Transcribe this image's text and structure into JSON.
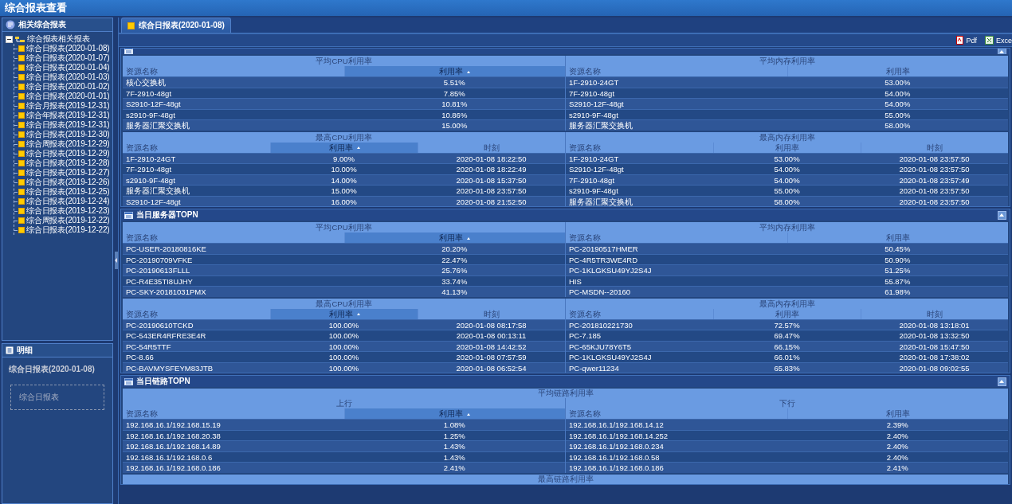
{
  "window": {
    "title": "综合报表查看"
  },
  "sidebar": {
    "related": {
      "title": "相关综合报表",
      "tree": {
        "label": "综合报表相关报表",
        "expanded": true,
        "children": [
          {
            "label": "综合日报表(2020-01-08)"
          },
          {
            "label": "综合日报表(2020-01-07)"
          },
          {
            "label": "综合日报表(2020-01-04)"
          },
          {
            "label": "综合日报表(2020-01-03)"
          },
          {
            "label": "综合日报表(2020-01-02)"
          },
          {
            "label": "综合日报表(2020-01-01)"
          },
          {
            "label": "综合月报表(2019-12-31)"
          },
          {
            "label": "综合年报表(2019-12-31)"
          },
          {
            "label": "综合日报表(2019-12-31)"
          },
          {
            "label": "综合日报表(2019-12-30)"
          },
          {
            "label": "综合周报表(2019-12-29)"
          },
          {
            "label": "综合日报表(2019-12-29)"
          },
          {
            "label": "综合日报表(2019-12-28)"
          },
          {
            "label": "综合日报表(2019-12-27)"
          },
          {
            "label": "综合日报表(2019-12-26)"
          },
          {
            "label": "综合日报表(2019-12-25)"
          },
          {
            "label": "综合日报表(2019-12-24)"
          },
          {
            "label": "综合日报表(2019-12-23)"
          },
          {
            "label": "综合周报表(2019-12-22)"
          },
          {
            "label": "综合日报表(2019-12-22)"
          }
        ]
      }
    },
    "detail": {
      "title": "明细",
      "report_name": "综合日报表(2020-01-08)",
      "item": "综合日报表"
    }
  },
  "tabs": [
    {
      "label": "综合日报表(2020-01-08)",
      "selected": true
    }
  ],
  "toolbar": {
    "buttons": [
      {
        "label": "Pdf",
        "kind": "pdf"
      },
      {
        "label": "Exce",
        "kind": "excel"
      }
    ]
  },
  "sections": [
    {
      "expanded": true,
      "blocks": [
        {
          "panes": [
            {
              "title": "平均CPU利用率",
              "columns": [
                {
                  "label": "资源名称",
                  "sorted": false
                },
                {
                  "label": "利用率",
                  "sorted": true
                }
              ],
              "rows": [
                [
                  "核心交换机",
                  "5.51%"
                ],
                [
                  "7F-2910-48gt",
                  "7.85%"
                ],
                [
                  "S2910-12F-48gt",
                  "10.81%"
                ],
                [
                  "s2910-9F-48gt",
                  "10.86%"
                ],
                [
                  "服务器汇聚交换机",
                  "15.00%"
                ]
              ]
            },
            {
              "title": "平均内存利用率",
              "columns": [
                {
                  "label": "资源名称",
                  "sorted": false
                },
                {
                  "label": "利用率",
                  "sorted": false
                }
              ],
              "rows": [
                [
                  "1F-2910-24GT",
                  "53.00%"
                ],
                [
                  "7F-2910-48gt",
                  "54.00%"
                ],
                [
                  "S2910-12F-48gt",
                  "54.00%"
                ],
                [
                  "s2910-9F-48gt",
                  "55.00%"
                ],
                [
                  "服务器汇聚交换机",
                  "58.00%"
                ]
              ]
            }
          ]
        },
        {
          "panes": [
            {
              "title": "最高CPU利用率",
              "columns": [
                {
                  "label": "资源名称",
                  "sorted": false
                },
                {
                  "label": "利用率",
                  "sorted": true
                },
                {
                  "label": "时刻",
                  "sorted": false
                }
              ],
              "rows": [
                [
                  "1F-2910-24GT",
                  "9.00%",
                  "2020-01-08 18:22:50"
                ],
                [
                  "7F-2910-48gt",
                  "10.00%",
                  "2020-01-08 18:22:49"
                ],
                [
                  "s2910-9F-48gt",
                  "14.00%",
                  "2020-01-08 15:37:50"
                ],
                [
                  "服务器汇聚交换机",
                  "15.00%",
                  "2020-01-08 23:57:50"
                ],
                [
                  "S2910-12F-48gt",
                  "16.00%",
                  "2020-01-08 21:52:50"
                ]
              ]
            },
            {
              "title": "最高内存利用率",
              "columns": [
                {
                  "label": "资源名称",
                  "sorted": false
                },
                {
                  "label": "利用率",
                  "sorted": false
                },
                {
                  "label": "时刻",
                  "sorted": false
                }
              ],
              "rows": [
                [
                  "1F-2910-24GT",
                  "53.00%",
                  "2020-01-08 23:57:50"
                ],
                [
                  "S2910-12F-48gt",
                  "54.00%",
                  "2020-01-08 23:57:50"
                ],
                [
                  "7F-2910-48gt",
                  "54.00%",
                  "2020-01-08 23:57:49"
                ],
                [
                  "s2910-9F-48gt",
                  "55.00%",
                  "2020-01-08 23:57:50"
                ],
                [
                  "服务器汇聚交换机",
                  "58.00%",
                  "2020-01-08 23:57:50"
                ]
              ]
            }
          ]
        }
      ]
    },
    {
      "title": "当日服务器TOPN",
      "expanded": true,
      "blocks": [
        {
          "panes": [
            {
              "title": "平均CPU利用率",
              "columns": [
                {
                  "label": "资源名称",
                  "sorted": false
                },
                {
                  "label": "利用率",
                  "sorted": true
                }
              ],
              "rows": [
                [
                  "PC-USER-20180816KE",
                  "20.20%"
                ],
                [
                  "PC-20190709VFKE",
                  "22.47%"
                ],
                [
                  "PC-20190613FLLL",
                  "25.76%"
                ],
                [
                  "PC-R4E35TI8UJHY",
                  "33.74%"
                ],
                [
                  "PC-SKY-20181031PMX",
                  "41.13%"
                ]
              ]
            },
            {
              "title": "平均内存利用率",
              "columns": [
                {
                  "label": "资源名称",
                  "sorted": false
                },
                {
                  "label": "利用率",
                  "sorted": false
                }
              ],
              "rows": [
                [
                  "PC-20190517HMER",
                  "50.45%"
                ],
                [
                  "PC-4R5TR3WE4RD",
                  "50.90%"
                ],
                [
                  "PC-1KLGKSU49YJ2S4J",
                  "51.25%"
                ],
                [
                  "HIS",
                  "55.87%"
                ],
                [
                  "PC-MSDN--20160",
                  "61.98%"
                ]
              ]
            }
          ]
        },
        {
          "panes": [
            {
              "title": "最高CPU利用率",
              "columns": [
                {
                  "label": "资源名称",
                  "sorted": false
                },
                {
                  "label": "利用率",
                  "sorted": true
                },
                {
                  "label": "时刻",
                  "sorted": false
                }
              ],
              "rows": [
                [
                  "PC-20190610TCKD",
                  "100.00%",
                  "2020-01-08 08:17:58"
                ],
                [
                  "PC-543ER4RFRE3E4R",
                  "100.00%",
                  "2020-01-08 00:13:11"
                ],
                [
                  "PC-54R5TTF",
                  "100.00%",
                  "2020-01-08 14:42:52"
                ],
                [
                  "PC-8.66",
                  "100.00%",
                  "2020-01-08 07:57:59"
                ],
                [
                  "PC-BAVMYSFEYM83JTB",
                  "100.00%",
                  "2020-01-08 06:52:54"
                ]
              ]
            },
            {
              "title": "最高内存利用率",
              "columns": [
                {
                  "label": "资源名称",
                  "sorted": false
                },
                {
                  "label": "利用率",
                  "sorted": false
                },
                {
                  "label": "时刻",
                  "sorted": false
                }
              ],
              "rows": [
                [
                  "PC-201810221730",
                  "72.57%",
                  "2020-01-08 13:18:01"
                ],
                [
                  "PC-7.185",
                  "69.47%",
                  "2020-01-08 13:32:50"
                ],
                [
                  "PC-65KJU78Y6T5",
                  "66.15%",
                  "2020-01-08 15:47:50"
                ],
                [
                  "PC-1KLGKSU49YJ2S4J",
                  "66.01%",
                  "2020-01-08 17:38:02"
                ],
                [
                  "PC-qwer11234",
                  "65.83%",
                  "2020-01-08 09:02:55"
                ]
              ]
            }
          ]
        }
      ]
    },
    {
      "title": "当日链路TOPN",
      "expanded": true,
      "blocks": [
        {
          "title": "平均链路利用率",
          "panes": [
            {
              "title": "上行",
              "columns": [
                {
                  "label": "资源名称",
                  "sorted": false
                },
                {
                  "label": "利用率",
                  "sorted": true
                }
              ],
              "rows": [
                [
                  "192.168.16.1/192.168.15.19",
                  "1.08%"
                ],
                [
                  "192.168.16.1/192.168.20.38",
                  "1.25%"
                ],
                [
                  "192.168.16.1/192.168.14.89",
                  "1.43%"
                ],
                [
                  "192.168.16.1/192.168.0.6",
                  "1.43%"
                ],
                [
                  "192.168.16.1/192.168.0.186",
                  "2.41%"
                ]
              ]
            },
            {
              "title": "下行",
              "columns": [
                {
                  "label": "资源名称",
                  "sorted": false
                },
                {
                  "label": "利用率",
                  "sorted": false
                }
              ],
              "rows": [
                [
                  "192.168.16.1/192.168.14.12",
                  "2.39%"
                ],
                [
                  "192.168.16.1/192.168.14.252",
                  "2.40%"
                ],
                [
                  "192.168.16.1/192.168.0.234",
                  "2.40%"
                ],
                [
                  "192.168.16.1/192.168.0.58",
                  "2.40%"
                ],
                [
                  "192.168.16.1/192.168.0.186",
                  "2.41%"
                ]
              ]
            }
          ]
        },
        {
          "title": "最高链路利用率"
        }
      ]
    }
  ]
}
